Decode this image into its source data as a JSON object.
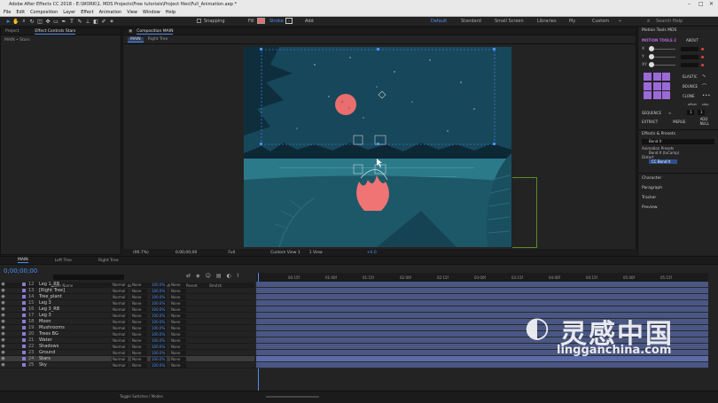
{
  "app": {
    "title": "Adobe After Effects CC 2018 - E:\\WORK\\1. MDS Projects\\Free tutorials\\Project files\\Full_Animation.aep *",
    "menu": [
      "File",
      "Edit",
      "Composition",
      "Layer",
      "Effect",
      "Animation",
      "View",
      "Window",
      "Help"
    ]
  },
  "toolbar": {
    "snapping": "Snapping",
    "fill": "Fill",
    "stroke": "Stroke",
    "stroke_value": "-",
    "add": "Add",
    "workspaces": [
      "Default",
      "Standard",
      "Small Screen",
      "Libraries",
      "My",
      "Custom"
    ],
    "active_workspace": "Default",
    "search_placeholder": "Search Help"
  },
  "left_panel": {
    "tabs": [
      "Project",
      "Effect Controls Stars"
    ],
    "breadcrumb": "MAIN • Stars"
  },
  "composition": {
    "tab": "Composition MAIN",
    "sub_tabs": [
      "MAIN",
      "Right Tree"
    ],
    "zoom": "(90.7%)",
    "time": "0;00;00;00",
    "resolution": "Full",
    "camera": "Custom View 1",
    "views": "1 View",
    "offset": "+0.0"
  },
  "motion_tools": {
    "title": "Motion Tools MDS",
    "logo": "MOTION TOOLS 2",
    "about": "ABOUT",
    "sliders": [
      {
        "key": "X",
        "value_pct": 0
      },
      {
        "key": "Y",
        "value_pct": 0
      },
      {
        "key": "XY",
        "value_pct": 0
      }
    ],
    "buttons": {
      "elastic": "ELASTIC",
      "bounce": "BOUNCE",
      "clone": "CLONE",
      "offset": "offset",
      "step": "step",
      "sequence": "SEQUENCE",
      "extract": "EXTRACT",
      "merge": "MERGE",
      "add_null": "ADD NULL"
    },
    "offset_value": "1",
    "step_value": "1"
  },
  "effects_presets": {
    "title": "Effects & Presets",
    "search_value": "Bend It",
    "tree": [
      {
        "label": "Animation Presets",
        "level": 0
      },
      {
        "label": "Bend It (txCamp)",
        "level": 1
      },
      {
        "label": "Distort",
        "level": 0
      },
      {
        "label": "CC Bend It",
        "level": 1
      }
    ],
    "collapsed_panels": [
      "Character",
      "Paragraph",
      "Tracker",
      "Preview"
    ]
  },
  "timeline": {
    "tabs": [
      "MAIN",
      "Left Tree",
      "Right Tree"
    ],
    "timecode": "0;00;00;00",
    "columns": [
      "Layer Name",
      "Mode",
      "T TrkMat",
      "Parent",
      "Stretch"
    ],
    "ruler": [
      "00:15f",
      "01:00f",
      "01:15f",
      "02:00f",
      "02:15f",
      "03:00f",
      "03:15f",
      "04:00f",
      "04:15f",
      "05:00f",
      "05:15f"
    ],
    "layers": [
      {
        "num": "12",
        "name": "Leg 1_RB",
        "mode": "Normal",
        "trkmat": "None",
        "stretch": "100.0%",
        "parent": "None",
        "color": "#8c7ad0"
      },
      {
        "num": "13",
        "name": "[Right Tree]",
        "mode": "Normal",
        "trkmat": "None",
        "stretch": "100.0%",
        "parent": "None",
        "color": "#8c7ad0"
      },
      {
        "num": "14",
        "name": "Tree_plant",
        "mode": "Normal",
        "trkmat": "None",
        "stretch": "100.0%",
        "parent": "None",
        "color": "#8c7ad0"
      },
      {
        "num": "15",
        "name": "Leg 3",
        "mode": "Normal",
        "trkmat": "None",
        "stretch": "100.0%",
        "parent": "None",
        "color": "#8c7ad0"
      },
      {
        "num": "16",
        "name": "Leg 3_RB",
        "mode": "Normal",
        "trkmat": "None",
        "stretch": "100.0%",
        "parent": "None",
        "color": "#8c7ad0"
      },
      {
        "num": "17",
        "name": "Leg 3",
        "mode": "Normal",
        "trkmat": "None",
        "stretch": "100.0%",
        "parent": "None",
        "color": "#8c7ad0"
      },
      {
        "num": "18",
        "name": "Moon",
        "mode": "Normal",
        "trkmat": "None",
        "stretch": "100.0%",
        "parent": "None",
        "color": "#8c7ad0"
      },
      {
        "num": "19",
        "name": "Mushrooms",
        "mode": "Normal",
        "trkmat": "None",
        "stretch": "100.0%",
        "parent": "None",
        "color": "#8c7ad0"
      },
      {
        "num": "20",
        "name": "Trees BG",
        "mode": "Normal",
        "trkmat": "None",
        "stretch": "100.0%",
        "parent": "None",
        "color": "#8c7ad0"
      },
      {
        "num": "21",
        "name": "Water",
        "mode": "Normal",
        "trkmat": "None",
        "stretch": "100.0%",
        "parent": "None",
        "color": "#8c7ad0"
      },
      {
        "num": "22",
        "name": "Shadows",
        "mode": "Normal",
        "trkmat": "None",
        "stretch": "100.0%",
        "parent": "None",
        "color": "#8c7ad0"
      },
      {
        "num": "23",
        "name": "Ground",
        "mode": "Normal",
        "trkmat": "None",
        "stretch": "100.0%",
        "parent": "None",
        "color": "#8c7ad0"
      },
      {
        "num": "24",
        "name": "Stars",
        "mode": "Normal",
        "trkmat": "None",
        "stretch": "100.0%",
        "parent": "None",
        "color": "#8c7ad0",
        "selected": true
      },
      {
        "num": "25",
        "name": "Sky",
        "mode": "Normal",
        "trkmat": "None",
        "stretch": "100.0%",
        "parent": "None",
        "color": "#8c7ad0"
      }
    ],
    "toggle_label": "Toggle Switches / Modes"
  },
  "watermark": {
    "cn": "灵感中国",
    "url": "lingganchina.com"
  },
  "colors": {
    "accent": "#4b8ff7",
    "sky": "#17475a",
    "moon": "#e96e6e",
    "flame": "#f07474",
    "layer_bar": "#4a5785",
    "layer_bar_selected": "#5a6ba8"
  }
}
